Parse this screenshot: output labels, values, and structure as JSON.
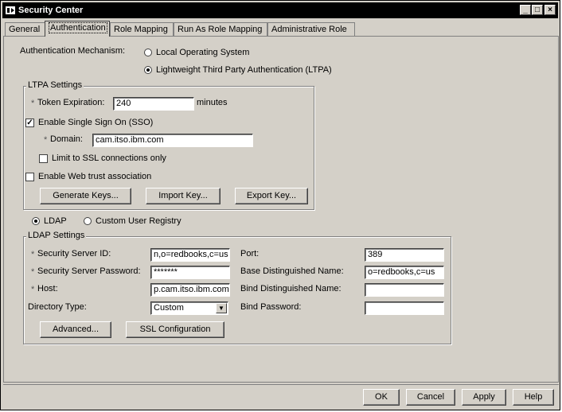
{
  "window": {
    "title": "Security Center",
    "controls": {
      "minimize": "_",
      "maximize": "□",
      "close": "×"
    }
  },
  "tabs": [
    {
      "label": "General"
    },
    {
      "label": "Authentication"
    },
    {
      "label": "Role Mapping"
    },
    {
      "label": "Run As Role Mapping"
    },
    {
      "label": "Administrative Role"
    }
  ],
  "auth": {
    "mechanism_label": "Authentication Mechanism:",
    "options": [
      {
        "label": "Local Operating System",
        "selected": false
      },
      {
        "label": "Lightweight Third Party Authentication (LTPA)",
        "selected": true
      }
    ]
  },
  "ltpa": {
    "group_label": "LTPA Settings",
    "required_mark": "*",
    "token_label": "Token Expiration:",
    "token_value": "240",
    "token_unit": "minutes",
    "sso_label": "Enable Single Sign On (SSO)",
    "sso_checked": true,
    "check_mark": "✓",
    "domain_label": "Domain:",
    "domain_value": "cam.itso.ibm.com",
    "ssl_only_label": "Limit to SSL connections only",
    "ssl_only_checked": false,
    "web_trust_label": "Enable Web trust association",
    "web_trust_checked": false,
    "buttons": {
      "generate": "Generate Keys...",
      "import": "Import Key...",
      "export": "Export Key..."
    }
  },
  "registry": {
    "ldap_label": "LDAP",
    "ldap_selected": true,
    "custom_label": "Custom User Registry",
    "custom_selected": false
  },
  "ldap": {
    "group_label": "LDAP Settings",
    "server_id_label": "Security Server ID:",
    "server_id_value": "n,o=redbooks,c=us",
    "server_password_label": "Security Server Password:",
    "server_password_value": "*******",
    "host_label": "Host:",
    "host_value": "p.cam.itso.ibm.com",
    "directory_type_label": "Directory Type:",
    "directory_type_value": "Custom",
    "port_label": "Port:",
    "port_value": "389",
    "base_dn_label": "Base Distinguished Name:",
    "base_dn_value": "o=redbooks,c=us",
    "bind_dn_label": "Bind Distinguished Name:",
    "bind_dn_value": "",
    "bind_password_label": "Bind Password:",
    "bind_password_value": "",
    "buttons": {
      "advanced": "Advanced...",
      "ssl_config": "SSL Configuration"
    }
  },
  "footer": {
    "ok": "OK",
    "cancel": "Cancel",
    "apply": "Apply",
    "help": "Help"
  }
}
